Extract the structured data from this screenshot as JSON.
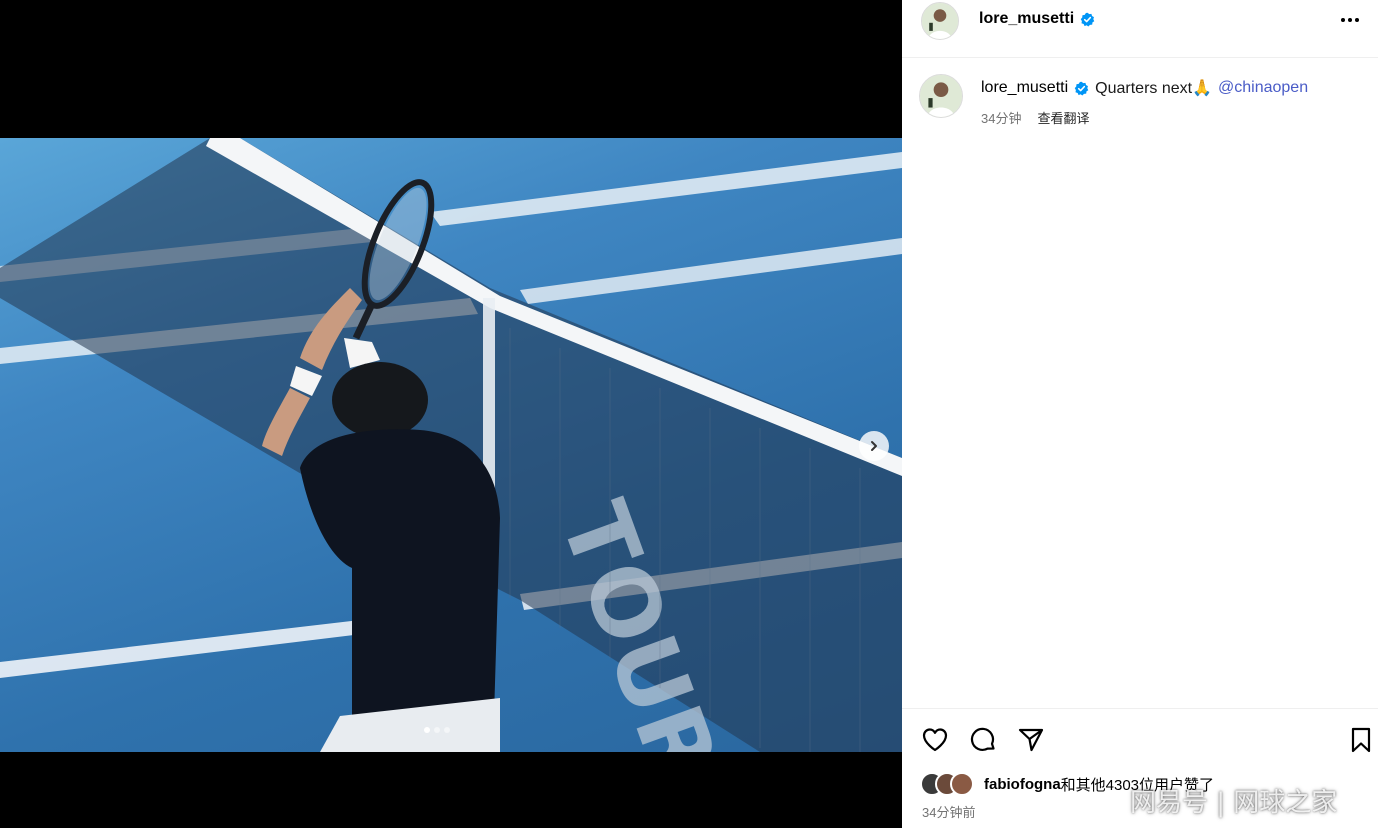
{
  "post": {
    "username": "lore_musetti",
    "verified": true,
    "caption_text": "Quarters next🙏",
    "caption_mention": "@chinaopen",
    "caption_time": "34分钟",
    "translate_label": "查看翻译",
    "net_text": "TOUR",
    "carousel": {
      "count": 3,
      "active_index": 0
    }
  },
  "likes": {
    "liker": "fabiofogna",
    "text": "和其他4303位用户赞了",
    "time_ago": "34分钟前"
  },
  "icons": {
    "more": "more-icon",
    "like": "heart-icon",
    "comment": "comment-icon",
    "share": "share-icon",
    "save": "bookmark-icon",
    "next": "chevron-right-icon",
    "verified": "verified-badge-icon"
  },
  "colors": {
    "court_blue": "#3f86c2",
    "verified_blue": "#0095f6",
    "mention_blue": "#4a5cc7"
  },
  "watermark": "网易号 | 网球之家"
}
